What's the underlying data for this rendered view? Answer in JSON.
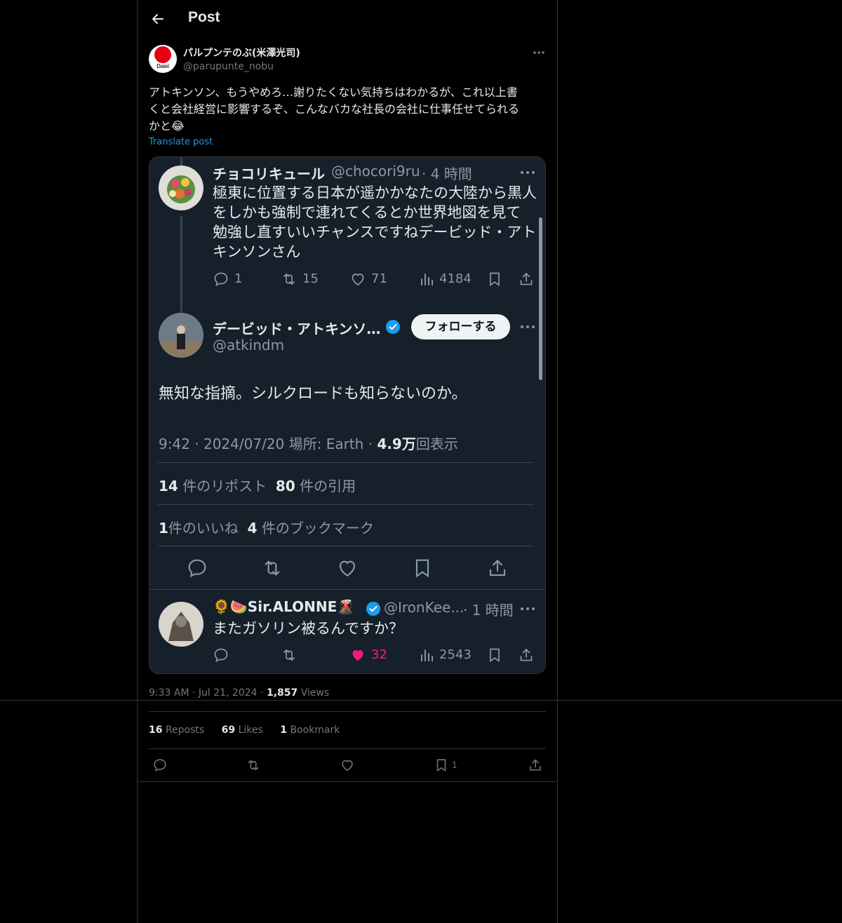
{
  "header": {
    "title": "Post"
  },
  "author": {
    "name": "パルプンテのぶ(米澤光司)",
    "handle": "@parupunte_nobu",
    "avatar_text": "Daiei"
  },
  "post": {
    "text_line1": "アトキンソン、もうやめろ…謝りたくない気持ちはわかるが、これ以上書",
    "text_line2": "くと会社経営に影響するぞ、こんなバカな社長の会社に仕事任せてられる",
    "text_line3": "かと😂",
    "translate": "Translate post"
  },
  "embed": {
    "parent": {
      "name": "チョコリキュール",
      "handle": "@chocori9ru",
      "time": "· 4 時間",
      "text": [
        "極東に位置する日本が遥かかなたの大陸から黒人",
        "をしかも強制で連れてくるとか世界地図を見て",
        "勉強し直すいいチャンスですねデービッド・アト",
        "キンソンさん"
      ],
      "replies": "1",
      "reposts": "15",
      "likes": "71",
      "views": "4184"
    },
    "main": {
      "name": "デービッド・アトキンソ…",
      "handle": "@atkindm",
      "follow": "フォローする",
      "text": "無知な指摘。シルクロードも知らないのか。",
      "time": "9:42 · 2024/07/20 場所: Earth ·",
      "views_num": "4.9万",
      "views_label": "回表示",
      "reposts_num": "14",
      "reposts_label": "件のリポスト",
      "quotes_num": "80",
      "quotes_label": "件の引用",
      "likes_num": "1",
      "likes_label": "件のいいね",
      "bookmarks_num": "4",
      "bookmarks_label": "件のブックマーク"
    },
    "reply": {
      "name": "🌻🍉Sir.ALONNE🌋",
      "handle": "@IronKee...",
      "time": "· 1 時間",
      "text": "またガソリン被るんですか？",
      "likes": "32",
      "views": "2543"
    }
  },
  "meta": {
    "time": "9:33 AM",
    "date": "Jul 21, 2024",
    "views_num": "1,857",
    "views_label": "Views"
  },
  "counts": {
    "reposts_num": "16",
    "reposts_label": "Reposts",
    "likes_num": "69",
    "likes_label": "Likes",
    "bookmarks_num": "1",
    "bookmarks_label": "Bookmark"
  },
  "actions": {
    "bookmark_count": "1"
  },
  "colors": {
    "accent": "#1d9bf0",
    "like_pink": "#f91880",
    "background": "#000000",
    "embed_bg": "#15202b"
  }
}
